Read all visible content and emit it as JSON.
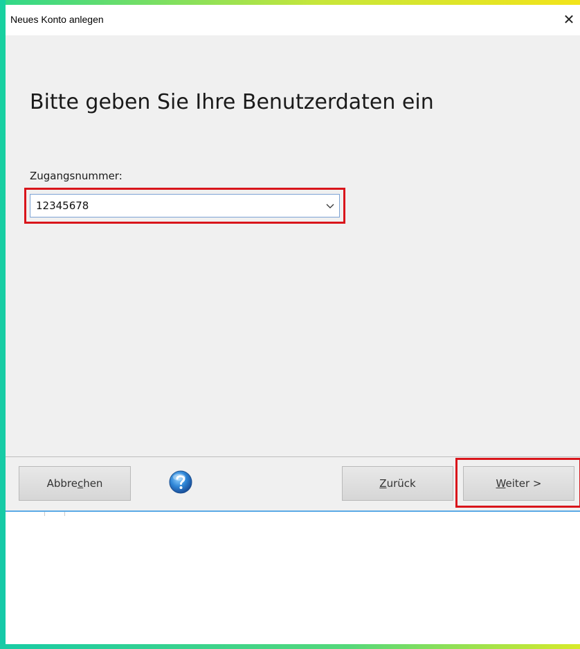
{
  "window": {
    "title": "Neues Konto anlegen",
    "close_symbol": "✕"
  },
  "main": {
    "heading": "Bitte geben Sie Ihre Benutzerdaten ein",
    "field_label": "Zugangsnummer:",
    "field_value": "12345678"
  },
  "footer": {
    "cancel_pre": "Abbre",
    "cancel_mnemonic": "c",
    "cancel_post": "hen",
    "back_mnemonic": "Z",
    "back_post": "urück",
    "next_mnemonic": "W",
    "next_post": "eiter >"
  },
  "colors": {
    "highlight": "#d9151b",
    "window_bg": "#f0f0f0",
    "accent_line": "#5aa9e6"
  }
}
